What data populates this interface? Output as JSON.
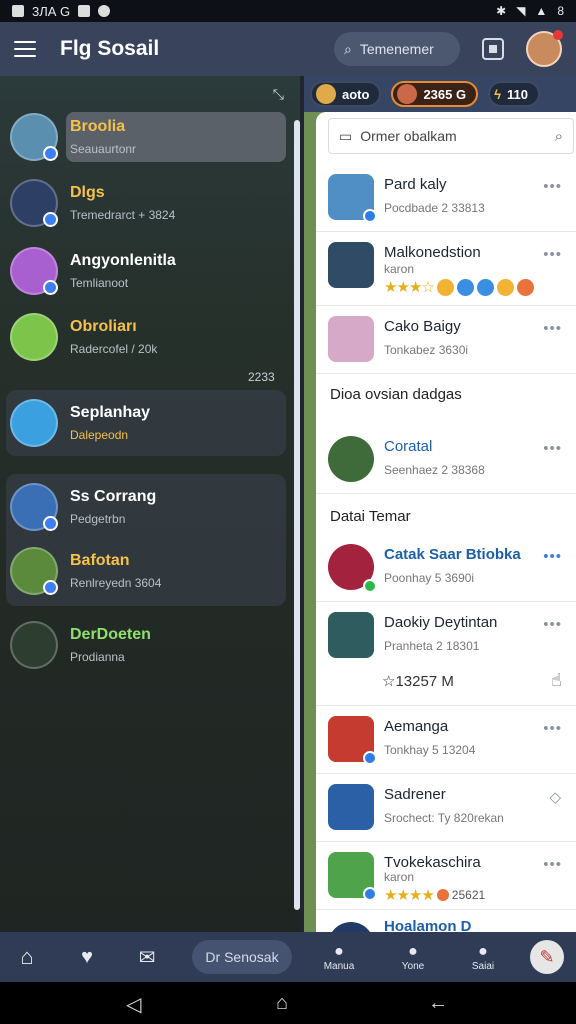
{
  "status": {
    "left": "3ЛА G",
    "right": "8"
  },
  "appbar": {
    "title": "Flg Sosail",
    "search": "Temenemer"
  },
  "left": {
    "chats": [
      {
        "name": "Broolia",
        "sub": "Seauaurtonr",
        "color": "#f5c14b"
      },
      {
        "name": "Dlgs",
        "sub": "Tremedrarct + 3824",
        "color": "#f5c14b"
      },
      {
        "name": "Angyonlenitla",
        "sub": "Temlianoot",
        "color": "#ffffff"
      },
      {
        "name": "Obroliarı",
        "sub": "Radercofel / 20k",
        "color": "#f5c14b"
      },
      {
        "name": "Seplanhay",
        "sub": "Dalepeodn",
        "color": "#ffffff"
      },
      {
        "name": "Ss Corrang",
        "sub": "Pedgetrbn",
        "color": "#ffffff"
      },
      {
        "name": "Bafotan",
        "sub": "Renlreyedn 3604",
        "color": "#f5c14b"
      },
      {
        "name": "DerDoeten",
        "sub": "Prodianna",
        "color": "#ffffff"
      }
    ],
    "unread_count": "2233"
  },
  "right": {
    "chips": [
      "aoto",
      "2365 G",
      "110"
    ],
    "search_placeholder": "Ormer obalkam",
    "rows": [
      {
        "name": "Pard kaly",
        "sub": "Pocdbade 2 33813"
      },
      {
        "name": "Malkonedstion",
        "sub": "karon"
      },
      {
        "name": "Cako Baigy",
        "sub": "Tonkabez 3630i"
      },
      {
        "name": "Coratal",
        "sub": "Seenhaez 2 38368"
      },
      {
        "name": "Catak Saar Btiobka",
        "sub": "Poonhay 5 3690i"
      },
      {
        "name": "Daokiy Deytintan",
        "sub": "Pranheta 2 18301"
      },
      {
        "name": "Aemanga",
        "sub": "Tonkhay 5 13204"
      },
      {
        "name": "Sadrener",
        "sub": "Srochect: Ty 820rekan"
      },
      {
        "name": "Tvokekaschira",
        "sub": "karon"
      },
      {
        "name": "Hoalamon D",
        "sub": ""
      }
    ],
    "section1": "Dioa ovsian dadgas",
    "section2": "Datai Temar",
    "likes": "13257 M",
    "rating_value": "25621"
  },
  "nav": {
    "pill": "Dr Senosak",
    "items": [
      "Manua",
      "Yone",
      "Saiai"
    ]
  }
}
